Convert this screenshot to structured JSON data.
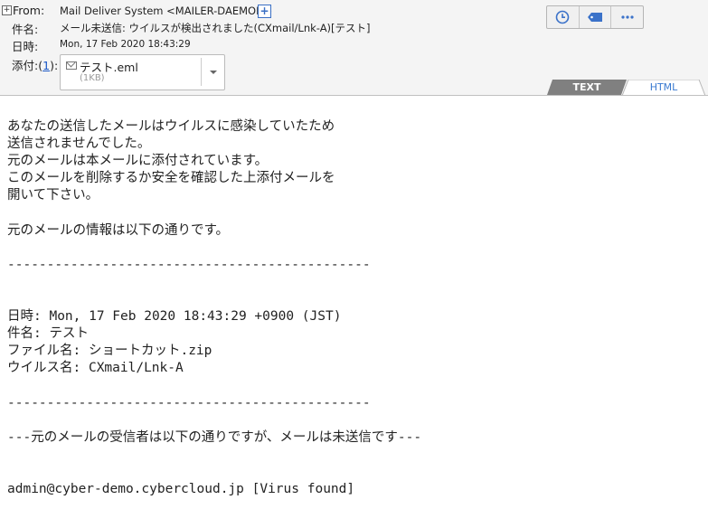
{
  "header": {
    "from_label": "From:",
    "from_value": "Mail Deliver System <MAILER-DAEMON>",
    "subject_label": "件名:",
    "subject_value": "メール未送信: ウイルスが検出されました(CXmail/Lnk-A)[テスト]",
    "date_label": "日時:",
    "date_value": "Mon, 17 Feb 2020 18:43:29",
    "attach_label_pre": "添付:",
    "attach_count": "1",
    "attachment": {
      "filename": "テスト.eml",
      "size": "(1KB)"
    },
    "toolbar_icons": [
      "clock-icon",
      "tag-icon",
      "more-icon"
    ]
  },
  "tabs": [
    {
      "label": "TEXT",
      "active": false
    },
    {
      "label": "HTML",
      "active": true
    }
  ],
  "body_lines": [
    "あなたの送信したメールはウイルスに感染していたため",
    "送信されませんでした。",
    "元のメールは本メールに添付されています。",
    "このメールを削除するか安全を確認した上添付メールを",
    "開いて下さい。",
    "",
    "元のメールの情報は以下の通りです。",
    "",
    "----------------------------------------------",
    "",
    "",
    "日時: Mon, 17 Feb 2020 18:43:29 +0900 (JST)",
    "件名: テスト",
    "ファイル名: ショートカット.zip",
    "ウイルス名: CXmail/Lnk-A",
    "",
    "----------------------------------------------",
    "",
    "---元のメールの受信者は以下の通りですが、メールは未送信です---",
    "",
    "",
    "admin@cyber-demo.cybercloud.jp [Virus found]"
  ],
  "colors": {
    "link": "#1a57c6",
    "tab_active_text": "#3a7ad0",
    "tab_inactive_bg": "#808080"
  }
}
